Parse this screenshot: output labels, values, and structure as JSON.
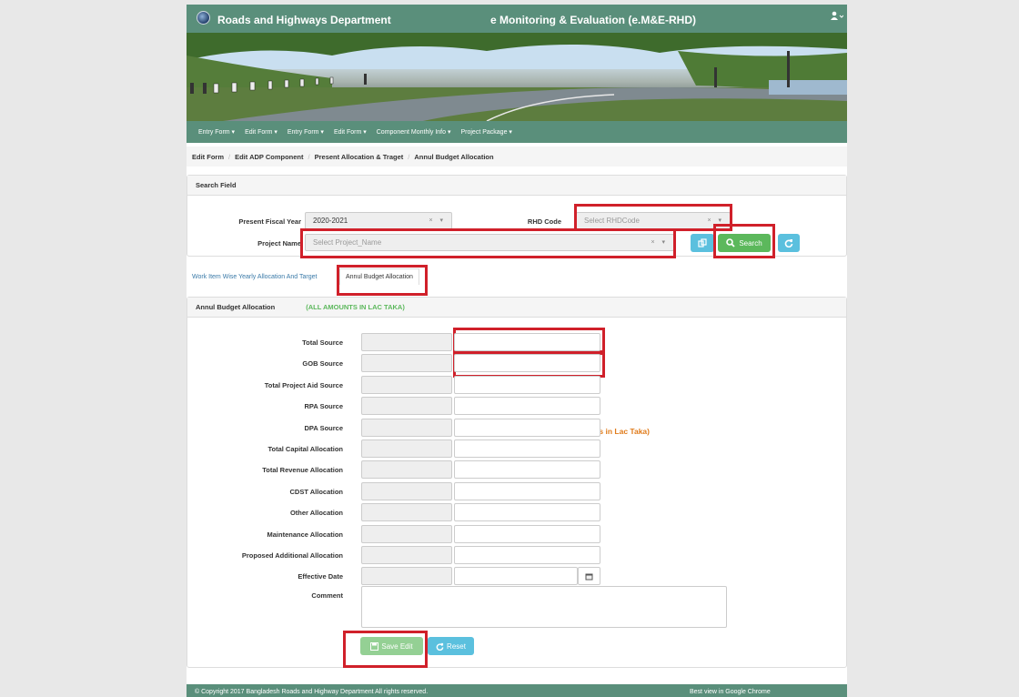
{
  "header": {
    "brand": "Roads and Highways Department",
    "app_title": "e Monitoring & Evaluation (e.M&E-RHD)",
    "user_icon": "user-icon"
  },
  "nav": {
    "items": [
      "Entry Form ▾",
      "Edit Form ▾",
      "Entry Form ▾",
      "Edit Form ▾",
      "Component Monthly Info ▾",
      "Project Package ▾"
    ]
  },
  "breadcrumb": [
    "Edit Form",
    "Edit ADP Component",
    "Present Allocation & Traget",
    "Annul Budget Allocation"
  ],
  "search": {
    "title": "Search Field",
    "fiscal_year_label": "Present Fiscal Year",
    "fiscal_year_value": "2020-2021",
    "rhd_code_label": "RHD Code",
    "rhd_code_placeholder": "Select RHDCode",
    "project_name_label": "Project Name",
    "project_name_placeholder": "Select Project_Name",
    "search_button": "Search",
    "clear_icon": "×",
    "dropdown_icon": "▾"
  },
  "tabs": {
    "tab1": "Work Item Wise Yearly Allocation And Target",
    "tab2": "Annul Budget Allocation"
  },
  "form": {
    "title": "Annul Budget Allocation",
    "subtitle": "(ALL AMOUNTS IN LAC TAKA)",
    "note": "(All Amounts in Lac Taka)",
    "fields": [
      "Total Source",
      "GOB Source",
      "Total Project Aid Source",
      "RPA Source",
      "DPA Source",
      "Total Capital Allocation",
      "Total Revenue Allocation",
      "CDST Allocation",
      "Other Allocation",
      "Maintenance Allocation",
      "Proposed Additional Allocation",
      "Effective Date"
    ],
    "comment_label": "Comment",
    "save_button": "Save Edit",
    "reset_button": "Reset"
  },
  "footer": {
    "copyright": "© Copyright 2017  Bangladesh Roads and Highway Department   All rights reserved.",
    "best_view": "Best view in Google Chrome"
  },
  "colors": {
    "theme": "#5a8f7b",
    "highlight": "#d0202a",
    "info": "#5bc0de",
    "success": "#5cb85c",
    "note": "#e07b1a",
    "subtitle": "#5cb85c"
  }
}
